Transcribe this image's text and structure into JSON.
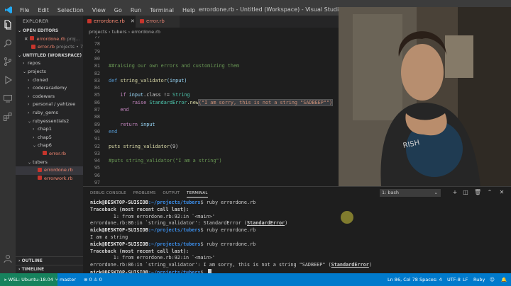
{
  "titlebar": {
    "menu": [
      "File",
      "Edit",
      "Selection",
      "View",
      "Go",
      "Run",
      "Terminal",
      "Help"
    ],
    "title": "errordone.rb - Untitled (Workspace) - Visual Studio Code"
  },
  "sidebar": {
    "header": "EXPLORER",
    "open_editors_label": "OPEN EDITORS",
    "open_editors": [
      {
        "close": "✕",
        "name": "errordone.rb",
        "sub": "proj..."
      },
      {
        "name": "error.rb",
        "sub": "projects • 7"
      }
    ],
    "workspace_label": "UNTITLED (WORKSPACE)",
    "tree": [
      {
        "twisty": "›",
        "name": "repos"
      },
      {
        "twisty": "⌄",
        "name": "projects"
      },
      {
        "twisty": "›",
        "name": "cloned"
      },
      {
        "twisty": "›",
        "name": "coderacademy"
      },
      {
        "twisty": "›",
        "name": "codewars"
      },
      {
        "twisty": "›",
        "name": "personal / yahtzee"
      },
      {
        "twisty": "›",
        "name": "ruby_gems"
      },
      {
        "twisty": "⌄",
        "name": "rubyessentials2"
      },
      {
        "twisty": "›",
        "name": "chap1"
      },
      {
        "twisty": "›",
        "name": "chap5"
      },
      {
        "twisty": "⌄",
        "name": "chap6"
      },
      {
        "name": "error.rb"
      },
      {
        "twisty": "⌄",
        "name": "tubers"
      },
      {
        "name": "errordone.rb"
      },
      {
        "name": "errorwork.rb"
      }
    ],
    "outline": "OUTLINE",
    "timeline": "TIMELINE"
  },
  "tabs": [
    {
      "name": "errordone.rb",
      "close": "✕"
    },
    {
      "name": "error.rb"
    }
  ],
  "breadcrumb": "projects › tubers › errordone.rb",
  "editor": {
    "lines": [
      {
        "n": "77"
      },
      {
        "n": "78"
      },
      {
        "n": "79"
      },
      {
        "n": "80"
      },
      {
        "n": "81",
        "text": "##raising our own errors and customizing them"
      },
      {
        "n": "82"
      },
      {
        "n": "83",
        "def": "def",
        "name": "string_validator",
        "args": "(input)"
      },
      {
        "n": "84"
      },
      {
        "n": "85",
        "if": "if",
        "obj": "input",
        "method": ".class != ",
        "cls": "String"
      },
      {
        "n": "86",
        "raise": "raise",
        "cls": "StandardError",
        "new": ".new",
        "str": "(\"I am sorry, this is not a string \"SADBEEP\"\")"
      },
      {
        "n": "87",
        "end": "end"
      },
      {
        "n": "88"
      },
      {
        "n": "89",
        "ret": "return",
        "val": "input"
      },
      {
        "n": "90",
        "end": "end"
      },
      {
        "n": "91"
      },
      {
        "n": "92",
        "puts": "puts",
        "call": "string_validator",
        "args": "(9)"
      },
      {
        "n": "93"
      },
      {
        "n": "94",
        "text": "#puts string_validator(\"I am a string\")"
      },
      {
        "n": "95"
      },
      {
        "n": "96"
      },
      {
        "n": "97"
      }
    ]
  },
  "panel": {
    "tabs": [
      "DEBUG CONSOLE",
      "PROBLEMS",
      "OUTPUT",
      "TERMINAL"
    ],
    "terminal_select": "1: bash",
    "terminal": {
      "prompt_user": "nick@DESKTOP-SUISIOB",
      "prompt_path": ":~/projects/tubers",
      "lines": [
        {
          "cmd": "$ ruby errordone.rb"
        },
        {
          "text": "Traceback (most recent call last):"
        },
        {
          "text": "        1: from errordone.rb:92:in `<main>'"
        },
        {
          "pre": "errordone.rb:86:in `string_validator': StandardError (",
          "u": "StandardError",
          "post": ")"
        },
        {
          "cmd": "$ ruby errordone.rb"
        },
        {
          "text": "I am a string"
        },
        {
          "cmd": "$ ruby errordone.rb"
        },
        {
          "text": "Traceback (most recent call last):"
        },
        {
          "text": "        1: from errordone.rb:92:in `<main>'"
        },
        {
          "pre": "errordone.rb:86:in `string_validator': I am sorry, this is not a string \"SADBEEP\" (",
          "u": "StandardError",
          "post": ")"
        },
        {
          "cmd": "$ "
        }
      ]
    }
  },
  "status": {
    "wsl": "WSL: Ubuntu-18.04",
    "branch": "master",
    "errors": "⊗ 0 ⚠ 0",
    "position": "Ln 86, Col 78",
    "spaces": "Spaces: 4",
    "encoding": "UTF-8",
    "eol": "LF",
    "language": "Ruby"
  },
  "colors": {
    "accent": "#007acc",
    "wsl": "#16825d",
    "modified_file": "#f48771"
  }
}
